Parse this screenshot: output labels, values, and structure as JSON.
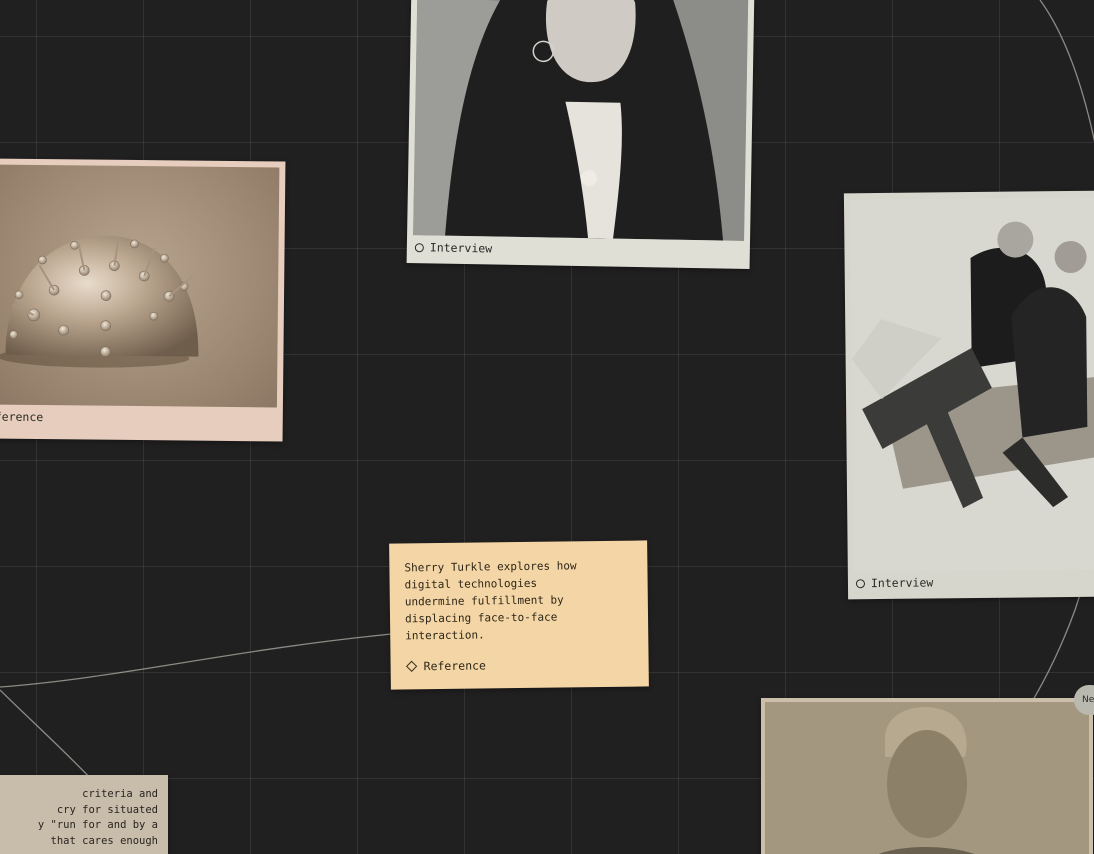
{
  "canvas": {
    "grid": true,
    "background_color": "#212020"
  },
  "cards": {
    "reference_photo": {
      "tag_label": "Reference",
      "tag_visible_text": "ference",
      "tag_icon": "circle-outline-icon",
      "image": "metallic-dome-sculpture-with-spikes",
      "color": "#e7cdbd"
    },
    "interview_top": {
      "tag_label": "Interview",
      "tag_icon": "circle-outline-icon",
      "image": "portrait-woman-long-dark-hair",
      "color": "#dfdfd6"
    },
    "interview_right": {
      "tag_label": "Interview",
      "tag_icon": "circle-outline-icon",
      "image": "two-people-sitting-on-sofa",
      "color": "#d7d6cc"
    },
    "note": {
      "text": "Sherry Turkle explores how\ndigital technologies\nundermine fulfillment by\ndisplacing face-to-face\ninteraction.",
      "tag_label": "Reference",
      "tag_icon": "diamond-outline-icon",
      "color": "#f4d6a6"
    },
    "note_bottom_left": {
      "text": "criteria and\ncry for situated\ny \"run for and by a\n that cares enough",
      "color": "#c8bcab"
    },
    "photo_bottom_right": {
      "image": "portrait-man-short-hair",
      "color": "#cbbfa9"
    }
  },
  "badge": {
    "label": "Ne"
  }
}
